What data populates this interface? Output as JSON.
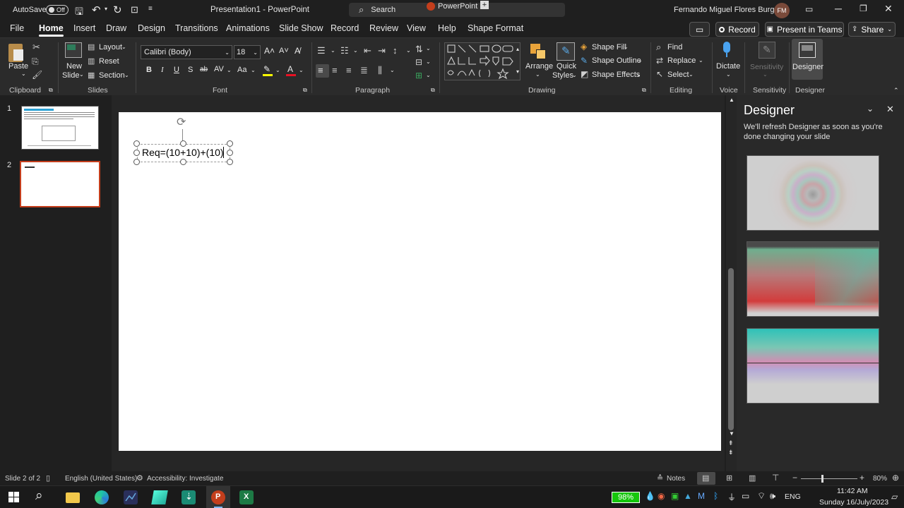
{
  "titlebar": {
    "autosave_label": "AutoSave",
    "autosave_state": "Off",
    "doc_title": "Presentation1  -  PowerPoint",
    "search_label": "Search",
    "app_tab": "PowerPoint",
    "user_name": "Fernando Miguel Flores Burgos",
    "user_initials": "FM"
  },
  "tabs": [
    "File",
    "Home",
    "Insert",
    "Draw",
    "Design",
    "Transitions",
    "Animations",
    "Slide Show",
    "Record",
    "Review",
    "View",
    "Help",
    "Shape Format"
  ],
  "actions": {
    "record": "Record",
    "teams": "Present in Teams",
    "share": "Share"
  },
  "ribbon": {
    "clipboard": {
      "paste": "Paste",
      "label": "Clipboard"
    },
    "slides": {
      "new_slide_1": "New",
      "new_slide_2": "Slide",
      "layout": "Layout",
      "reset": "Reset",
      "section": "Section",
      "label": "Slides"
    },
    "font": {
      "font_name": "Calibri (Body)",
      "font_size": "18",
      "label": "Font",
      "bold": "B",
      "italic": "I",
      "underline": "U",
      "shadow": "S",
      "strike": "ab",
      "spacing": "AV",
      "case": "Aa"
    },
    "paragraph": {
      "label": "Paragraph"
    },
    "drawing": {
      "arrange": "Arrange",
      "quick_styles_1": "Quick",
      "quick_styles_2": "Styles",
      "shape_fill": "Shape Fill",
      "shape_outline": "Shape Outline",
      "shape_effects": "Shape Effects",
      "label": "Drawing"
    },
    "editing": {
      "find": "Find",
      "replace": "Replace",
      "select": "Select",
      "label": "Editing"
    },
    "voice": {
      "dictate": "Dictate",
      "label": "Voice"
    },
    "sensitivity": {
      "button": "Sensitivity",
      "label": "Sensitivity"
    },
    "designer": {
      "button": "Designer",
      "label": "Designer"
    }
  },
  "slides": [
    {
      "number": "1"
    },
    {
      "number": "2"
    }
  ],
  "slide_text": "Req=(10+10)+(10)",
  "designer_pane": {
    "title": "Designer",
    "message": "We'll refresh Designer as soon as you're done changing your slide"
  },
  "status": {
    "slide_info": "Slide 2 of 2",
    "language": "English (United States)",
    "accessibility": "Accessibility: Investigate",
    "notes": "Notes",
    "zoom": "80%"
  },
  "taskbar": {
    "battery": "98%",
    "language": "ENG",
    "time": "11:42 AM",
    "date": "Sunday 16/July/2023"
  },
  "colors": {
    "accent": "#c43e1c",
    "selected_tab": "#ffffff",
    "battery_green": "#16c60c"
  }
}
